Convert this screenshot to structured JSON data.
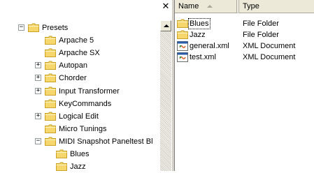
{
  "tree": {
    "close_glyph": "✕",
    "items": [
      {
        "label": "Presets",
        "expander": "−",
        "level": 0
      },
      {
        "label": "Arpache 5",
        "expander": "",
        "level": 1
      },
      {
        "label": "Arpache SX",
        "expander": "",
        "level": 1
      },
      {
        "label": "Autopan",
        "expander": "+",
        "level": 1
      },
      {
        "label": "Chorder",
        "expander": "+",
        "level": 1
      },
      {
        "label": "Input Transformer",
        "expander": "+",
        "level": 1
      },
      {
        "label": "KeyCommands",
        "expander": "",
        "level": 1
      },
      {
        "label": "Logical Edit",
        "expander": "+",
        "level": 1
      },
      {
        "label": "Micro Tunings",
        "expander": "",
        "level": 1
      },
      {
        "label": "MIDI Snapshot Paneltest Bl",
        "expander": "−",
        "level": 1
      },
      {
        "label": "Blues",
        "expander": "",
        "level": 2
      },
      {
        "label": "Jazz",
        "expander": "",
        "level": 2
      }
    ]
  },
  "list": {
    "columns": {
      "name": "Name",
      "type": "Type"
    },
    "rows": [
      {
        "name": "Blues",
        "type": "File Folder",
        "icon": "folder-icon",
        "focused": true
      },
      {
        "name": "Jazz",
        "type": "File Folder",
        "icon": "folder-icon",
        "focused": false
      },
      {
        "name": "general.xml",
        "type": "XML Document",
        "icon": "xml-document-icon",
        "focused": false
      },
      {
        "name": "test.xml",
        "type": "XML Document",
        "icon": "xml-document-icon",
        "focused": false
      }
    ]
  },
  "colors": {
    "folder_fill": "#f5d76e",
    "folder_edge": "#c9a227",
    "xml_blue": "#2a5caa"
  }
}
